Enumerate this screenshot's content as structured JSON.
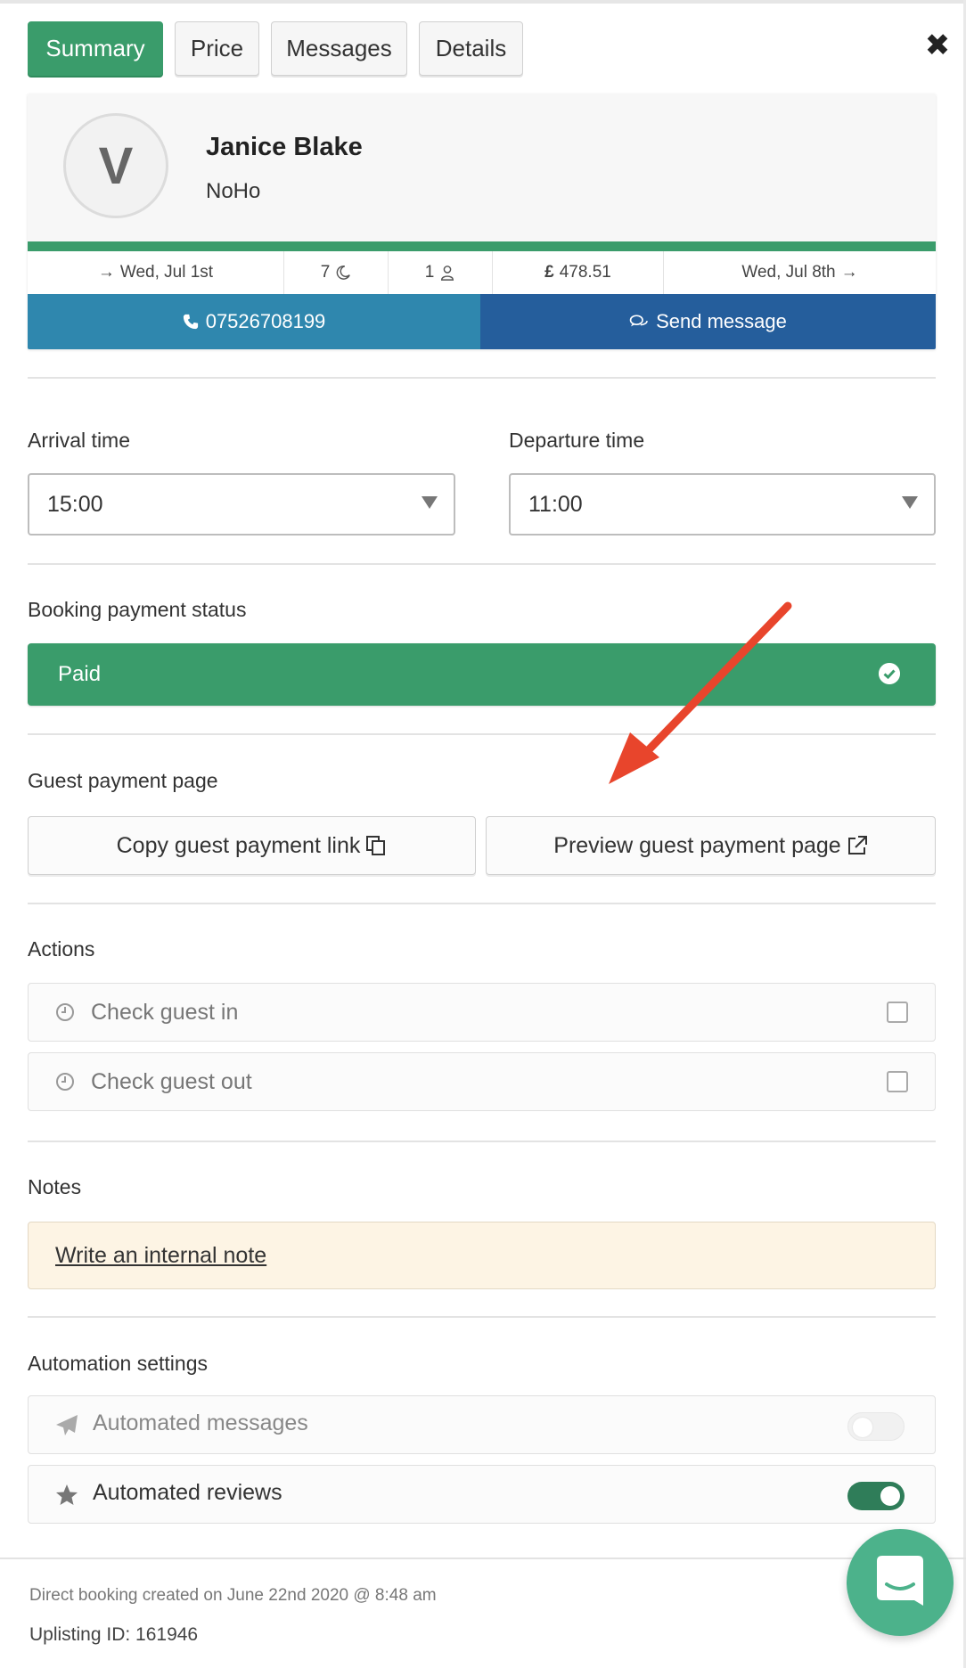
{
  "tabs": [
    {
      "label": "Summary",
      "active": true
    },
    {
      "label": "Price",
      "active": false
    },
    {
      "label": "Messages",
      "active": false
    },
    {
      "label": "Details",
      "active": false
    }
  ],
  "close_label": "✖",
  "guest": {
    "avatar_initial": "V",
    "name": "Janice Blake",
    "location": "NoHo",
    "checkin": "Wed, Jul 1st",
    "nights": "7",
    "guests": "1",
    "currency_symbol": "£",
    "total": "478.51",
    "checkout": "Wed, Jul 8th",
    "phone": "07526708199",
    "send_message_label": "Send message"
  },
  "times": {
    "arrival_label": "Arrival time",
    "arrival_value": "15:00",
    "departure_label": "Departure time",
    "departure_value": "11:00"
  },
  "payment": {
    "section_label": "Booking payment status",
    "status": "Paid"
  },
  "guest_payment": {
    "section_label": "Guest payment page",
    "copy_label": "Copy guest payment link",
    "preview_label": "Preview guest payment page"
  },
  "actions": {
    "section_label": "Actions",
    "items": [
      {
        "label": "Check guest in",
        "checked": false
      },
      {
        "label": "Check guest out",
        "checked": false
      }
    ]
  },
  "notes": {
    "section_label": "Notes",
    "placeholder_link": "Write an internal note"
  },
  "automation": {
    "section_label": "Automation settings",
    "items": [
      {
        "label": "Automated messages",
        "enabled": false,
        "icon": "paper-plane-icon"
      },
      {
        "label": "Automated reviews",
        "enabled": true,
        "icon": "star-icon"
      }
    ]
  },
  "footer": {
    "created": "Direct booking created on June 22nd 2020 @ 8:48 am",
    "uplisting_id": "Uplisting ID: 161946"
  },
  "colors": {
    "green": "#3a9c6b",
    "phone_blue": "#2f87ae",
    "message_blue": "#255e9c",
    "note_bg": "#fdf4e4",
    "annotation_arrow": "#e8452c",
    "chat_green": "#4cb28b"
  }
}
